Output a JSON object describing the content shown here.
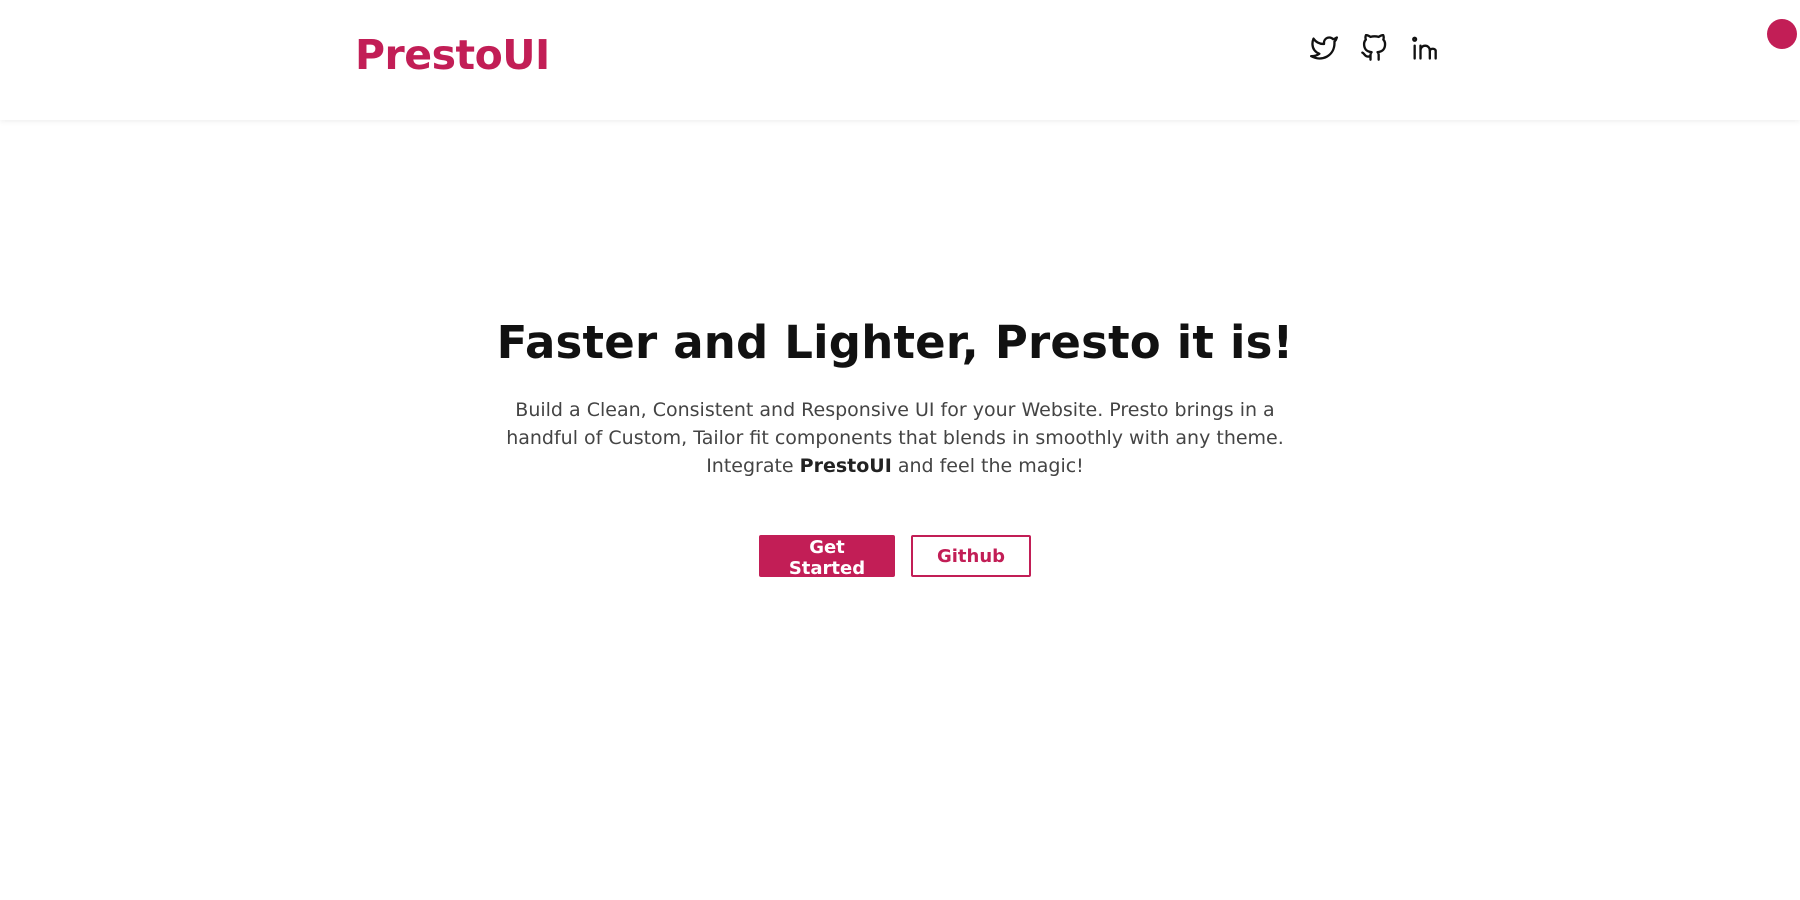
{
  "brand": {
    "name": "PrestoUI",
    "color": "#c21e56"
  },
  "social": [
    {
      "name": "twitter-icon",
      "label": "Twitter"
    },
    {
      "name": "github-icon",
      "label": "GitHub"
    },
    {
      "name": "linkedin-icon",
      "label": "LinkedIn"
    }
  ],
  "hero": {
    "title": "Faster and Lighter, Presto it is!",
    "description_line1": "Build a Clean, Consistent and Responsive UI for your Website. Presto brings in a handful of Custom, Tailor fit components that blends in smoothly with any theme.",
    "description_prefix": "Integrate ",
    "description_emphasis": "PrestoUI",
    "description_suffix": " and feel the magic!"
  },
  "actions": {
    "primary_label": "Get Started",
    "secondary_label": "Github"
  }
}
